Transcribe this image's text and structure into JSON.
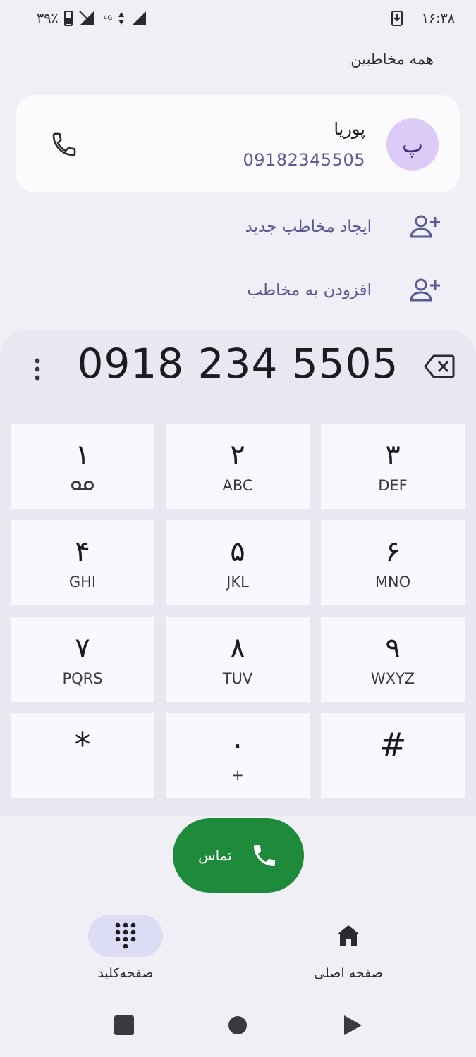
{
  "status_bar": {
    "time": "۱۶:۳۸",
    "battery_percent": "۳۹٪",
    "network": "4G"
  },
  "section_title": "همه مخاطبین",
  "contact": {
    "avatar_letter": "پ",
    "name": "پوریا",
    "number": "09182345505"
  },
  "actions": {
    "create_contact": "ایجاد مخاطب جدید",
    "add_to_contact": "افزودن به مخاطب"
  },
  "dialer": {
    "digits": "0918 234 5505"
  },
  "keys": [
    {
      "main": "۱",
      "sub": ""
    },
    {
      "main": "۲",
      "sub": "ABC"
    },
    {
      "main": "۳",
      "sub": "DEF"
    },
    {
      "main": "۴",
      "sub": "GHI"
    },
    {
      "main": "۵",
      "sub": "JKL"
    },
    {
      "main": "۶",
      "sub": "MNO"
    },
    {
      "main": "۷",
      "sub": "PQRS"
    },
    {
      "main": "۸",
      "sub": "TUV"
    },
    {
      "main": "۹",
      "sub": "WXYZ"
    },
    {
      "main": "*",
      "sub": ""
    },
    {
      "main": "۰",
      "sub": "+"
    },
    {
      "main": "#",
      "sub": ""
    }
  ],
  "call_button": {
    "label": "تماس"
  },
  "bottom_nav": {
    "keypad": "صفحه‌کلید",
    "home": "صفحه اصلی"
  },
  "colors": {
    "accent_green": "#1e8a3b",
    "avatar_bg": "#dccbf6",
    "link_purple": "#5a5a96"
  }
}
